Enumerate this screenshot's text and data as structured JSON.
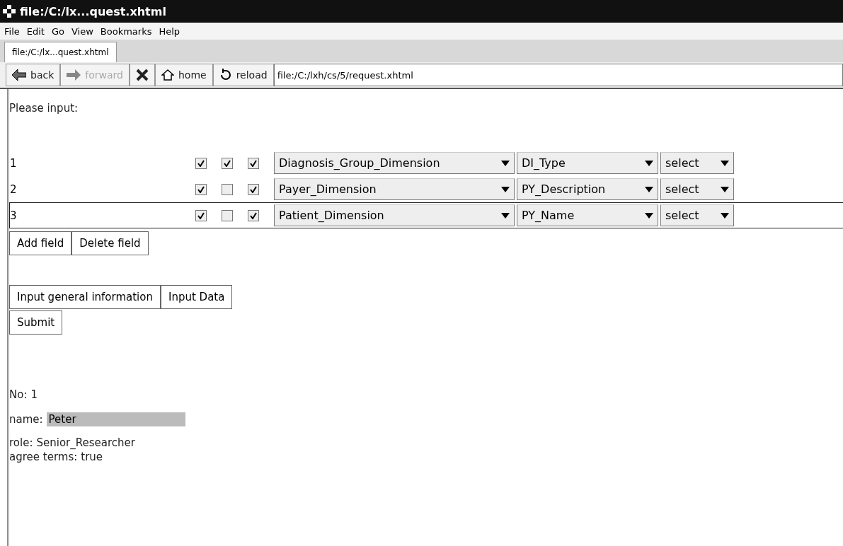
{
  "window": {
    "title": "file:/C:/lx...quest.xhtml"
  },
  "menu": [
    "File",
    "Edit",
    "Go",
    "View",
    "Bookmarks",
    "Help"
  ],
  "tabs": [
    {
      "label": "file:/C:/lx...quest.xhtml",
      "selected": true
    }
  ],
  "toolbar": {
    "buttons": [
      {
        "kind": "back",
        "label": "back",
        "disabled": false
      },
      {
        "kind": "forward",
        "label": "forward",
        "disabled": true
      },
      {
        "kind": "stop",
        "disabled": false
      },
      {
        "kind": "home",
        "label": "home",
        "disabled": false
      },
      {
        "kind": "reload",
        "label": "reload",
        "disabled": false
      }
    ],
    "address": "file:/C:/lxh/cs/5/request.xhtml"
  },
  "prompt": "Please input:",
  "rows": [
    {
      "number": "1",
      "focused": false,
      "checks": [
        true,
        true,
        true
      ],
      "dimension": "Diagnosis_Group_Dimension",
      "attribute": "DI_Type",
      "operation": "select"
    },
    {
      "number": "2",
      "focused": false,
      "checks": [
        true,
        false,
        true
      ],
      "dimension": "Payer_Dimension",
      "attribute": "PY_Description",
      "operation": "select"
    },
    {
      "number": "3",
      "focused": true,
      "checks": [
        true,
        false,
        true
      ],
      "dimension": "Patient_Dimension",
      "attribute": "PY_Name",
      "operation": "select"
    }
  ],
  "field_buttons": [
    "Add field",
    "Delete field"
  ],
  "input_buttons": [
    "Input general information",
    "Input Data"
  ],
  "submit": "Submit",
  "info": {
    "no_label": "No:",
    "no": "1",
    "name_label": "name:",
    "name": "Peter",
    "role_label": "role:",
    "role": "Senior_Researcher",
    "agree_label": "agree terms:",
    "agree": "true"
  }
}
